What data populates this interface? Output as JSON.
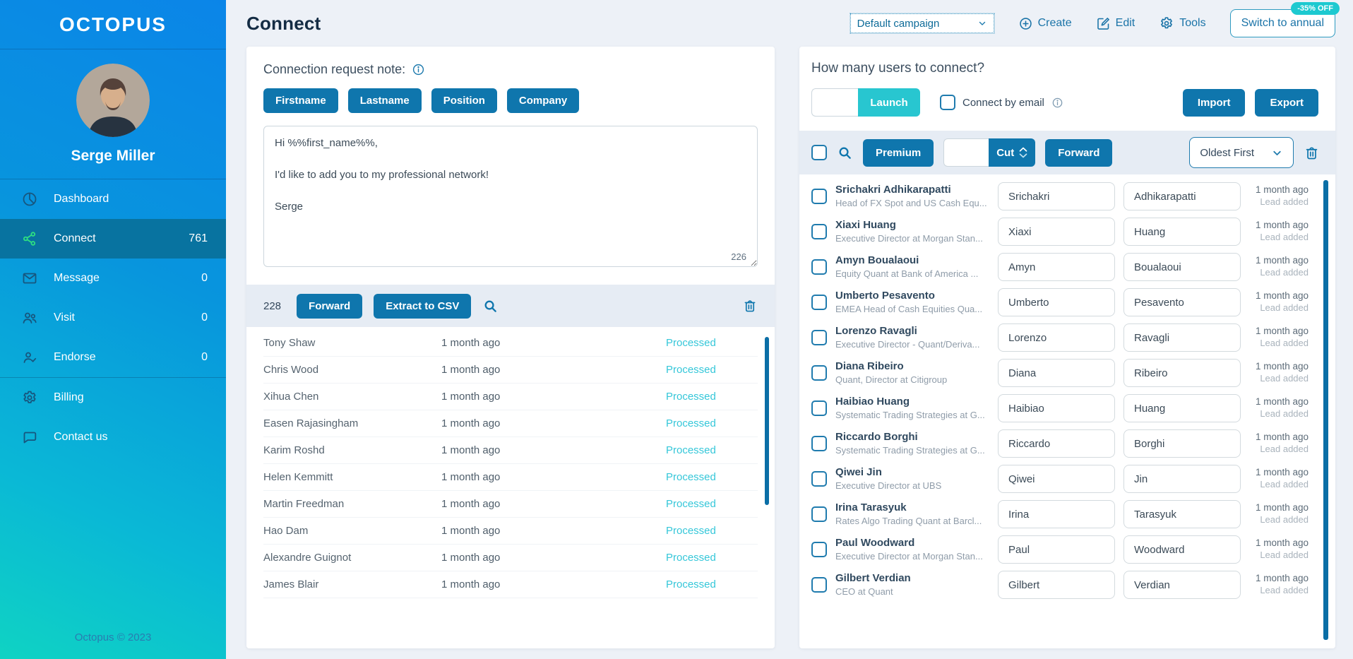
{
  "sidebar": {
    "logo": "OCTOPUS",
    "user_name": "Serge Miller",
    "nav": [
      {
        "label": "Dashboard",
        "icon": "dashboard-icon"
      },
      {
        "label": "Connect",
        "icon": "share-icon",
        "count": "761",
        "active": true
      },
      {
        "label": "Message",
        "icon": "envelope-icon",
        "count": "0"
      },
      {
        "label": "Visit",
        "icon": "people-icon",
        "count": "0"
      },
      {
        "label": "Endorse",
        "icon": "person-check-icon",
        "count": "0"
      }
    ],
    "secondary_nav": [
      {
        "label": "Billing",
        "icon": "gear-icon"
      },
      {
        "label": "Contact us",
        "icon": "chat-icon"
      }
    ],
    "footer": "Octopus © 2023"
  },
  "header": {
    "title": "Connect",
    "campaign_selected": "Default campaign",
    "create_label": "Create",
    "edit_label": "Edit",
    "tools_label": "Tools",
    "switch_annual_label": "Switch to annual",
    "discount_badge": "-35% OFF"
  },
  "left_panel": {
    "note_label": "Connection request note:",
    "variables": [
      {
        "label": "Firstname"
      },
      {
        "label": "Lastname"
      },
      {
        "label": "Position"
      },
      {
        "label": "Company"
      }
    ],
    "message": "Hi %%first_name%%,\n\nI'd like to add you to my professional network!\n\nSerge",
    "char_count": "226",
    "queue_count": "228",
    "forward_label": "Forward",
    "extract_label": "Extract to CSV",
    "rows": [
      {
        "name": "Tony Shaw",
        "time": "1 month ago",
        "status": "Processed"
      },
      {
        "name": "Chris Wood",
        "time": "1 month ago",
        "status": "Processed"
      },
      {
        "name": "Xihua Chen",
        "time": "1 month ago",
        "status": "Processed"
      },
      {
        "name": "Easen Rajasingham",
        "time": "1 month ago",
        "status": "Processed"
      },
      {
        "name": "Karim Roshd",
        "time": "1 month ago",
        "status": "Processed"
      },
      {
        "name": "Helen Kemmitt",
        "time": "1 month ago",
        "status": "Processed"
      },
      {
        "name": "Martin Freedman",
        "time": "1 month ago",
        "status": "Processed"
      },
      {
        "name": "Hao Dam",
        "time": "1 month ago",
        "status": "Processed"
      },
      {
        "name": "Alexandre Guignot",
        "time": "1 month ago",
        "status": "Processed"
      },
      {
        "name": "James Blair",
        "time": "1 month ago",
        "status": "Processed"
      }
    ]
  },
  "right_panel": {
    "heading": "How many users to connect?",
    "launch_label": "Launch",
    "connect_by_email_label": "Connect by email",
    "import_label": "Import",
    "export_label": "Export",
    "premium_label": "Premium",
    "cut_label": "Cut",
    "forward_label": "Forward",
    "sort_selected": "Oldest First",
    "users": [
      {
        "name": "Srichakri Adhikarapatti",
        "title": "Head of FX Spot and US Cash Equ...",
        "first": "Srichakri",
        "last": "Adhikarapatti",
        "time": "1 month ago",
        "status": "Lead added"
      },
      {
        "name": "Xiaxi Huang",
        "title": "Executive Director at Morgan Stan...",
        "first": "Xiaxi",
        "last": "Huang",
        "time": "1 month ago",
        "status": "Lead added"
      },
      {
        "name": "Amyn Boualaoui",
        "title": "Equity Quant at Bank of America ...",
        "first": "Amyn",
        "last": "Boualaoui",
        "time": "1 month ago",
        "status": "Lead added"
      },
      {
        "name": "Umberto Pesavento",
        "title": "EMEA Head of Cash Equities Qua...",
        "first": "Umberto",
        "last": "Pesavento",
        "time": "1 month ago",
        "status": "Lead added"
      },
      {
        "name": "Lorenzo Ravagli",
        "title": "Executive Director - Quant/Deriva...",
        "first": "Lorenzo",
        "last": "Ravagli",
        "time": "1 month ago",
        "status": "Lead added"
      },
      {
        "name": "Diana Ribeiro",
        "title": "Quant, Director at Citigroup",
        "first": "Diana",
        "last": "Ribeiro",
        "time": "1 month ago",
        "status": "Lead added"
      },
      {
        "name": "Haibiao Huang",
        "title": "Systematic Trading Strategies at G...",
        "first": "Haibiao",
        "last": "Huang",
        "time": "1 month ago",
        "status": "Lead added"
      },
      {
        "name": "Riccardo Borghi",
        "title": "Systematic Trading Strategies at G...",
        "first": "Riccardo",
        "last": "Borghi",
        "time": "1 month ago",
        "status": "Lead added"
      },
      {
        "name": "Qiwei Jin",
        "title": "Executive Director at UBS",
        "first": "Qiwei",
        "last": "Jin",
        "time": "1 month ago",
        "status": "Lead added"
      },
      {
        "name": "Irina Tarasyuk",
        "title": "Rates Algo Trading Quant at Barcl...",
        "first": "Irina",
        "last": "Tarasyuk",
        "time": "1 month ago",
        "status": "Lead added"
      },
      {
        "name": "Paul Woodward",
        "title": "Executive Director at Morgan Stan...",
        "first": "Paul",
        "last": "Woodward",
        "time": "1 month ago",
        "status": "Lead added"
      },
      {
        "name": "Gilbert Verdian",
        "title": "CEO at Quant",
        "first": "Gilbert",
        "last": "Verdian",
        "time": "1 month ago",
        "status": "Lead added"
      }
    ]
  },
  "colors": {
    "accent_blue": "#0f76ad",
    "turquoise": "#28c6d0",
    "processed_cyan": "#35c7d9",
    "sidebar_gradient_top": "#0b85e8",
    "sidebar_gradient_bottom": "#0fd3c3",
    "active_nav_bg": "#0873a0",
    "active_icon_green": "#2ee081"
  }
}
